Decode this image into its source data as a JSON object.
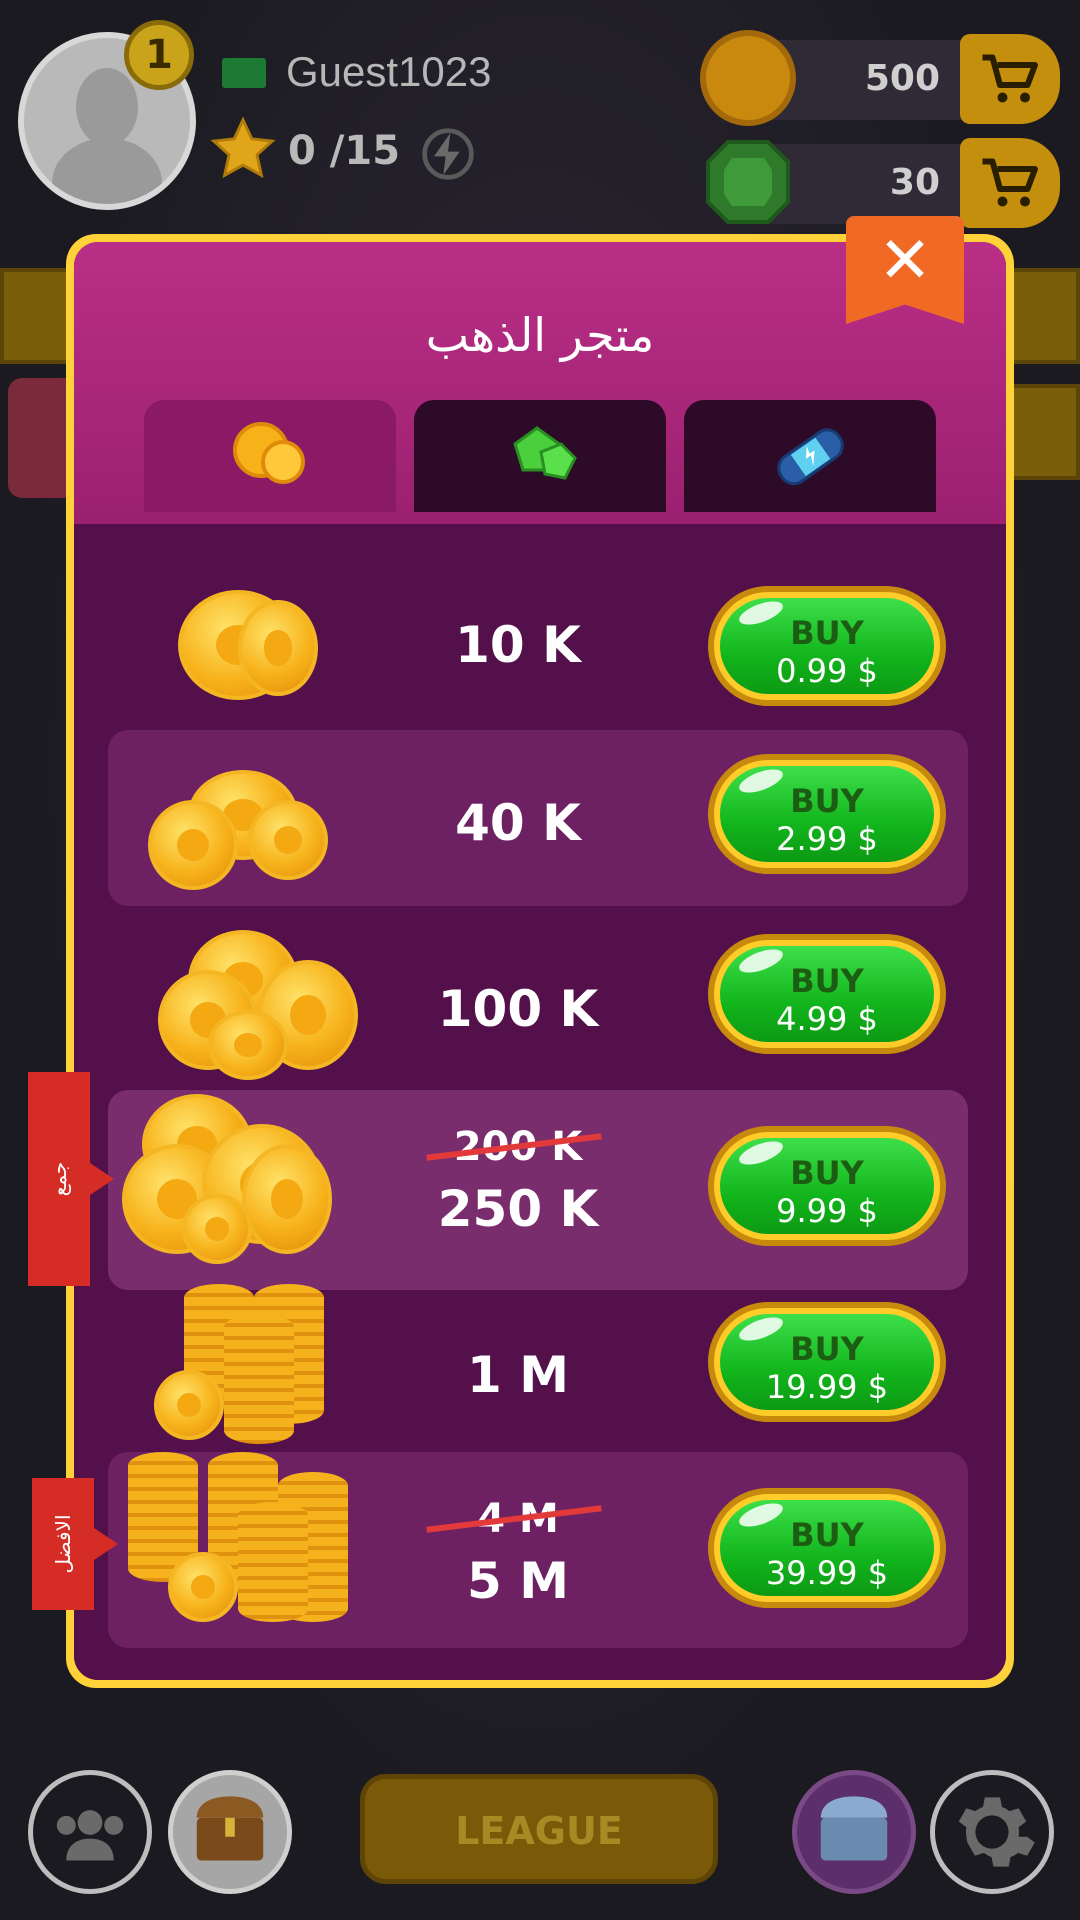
{
  "player": {
    "level": "1",
    "username": "Guest1023",
    "stars": "0 /15"
  },
  "currencies": {
    "gold": "500",
    "gems": "30"
  },
  "modal": {
    "title": "متجر الذهب",
    "close": "✕",
    "tabs": [
      {
        "icon": "gold-coins-icon"
      },
      {
        "icon": "green-gems-icon"
      },
      {
        "icon": "energy-capsule-icon"
      }
    ]
  },
  "packs": [
    {
      "amount": "10 K",
      "buy": "BUY",
      "price": "0.99 $"
    },
    {
      "amount": "40 K",
      "buy": "BUY",
      "price": "2.99 $"
    },
    {
      "amount": "100 K",
      "buy": "BUY",
      "price": "4.99 $"
    },
    {
      "old": "200 K",
      "amount": "250 K",
      "buy": "BUY",
      "price": "9.99 $"
    },
    {
      "amount": "1 M",
      "buy": "BUY",
      "price": "19.99 $"
    },
    {
      "old": "4 M",
      "amount": "5 M",
      "buy": "BUY",
      "price": "39.99 $"
    }
  ],
  "ribbons": {
    "popular": "جمع",
    "best": "الافضل"
  },
  "bottom": {
    "league": "LEAGUE"
  },
  "colors": {
    "accent_gold": "#ffd23a",
    "buy_green": "#12b51c",
    "panel": "#53104a",
    "header": "#b02a7d"
  }
}
